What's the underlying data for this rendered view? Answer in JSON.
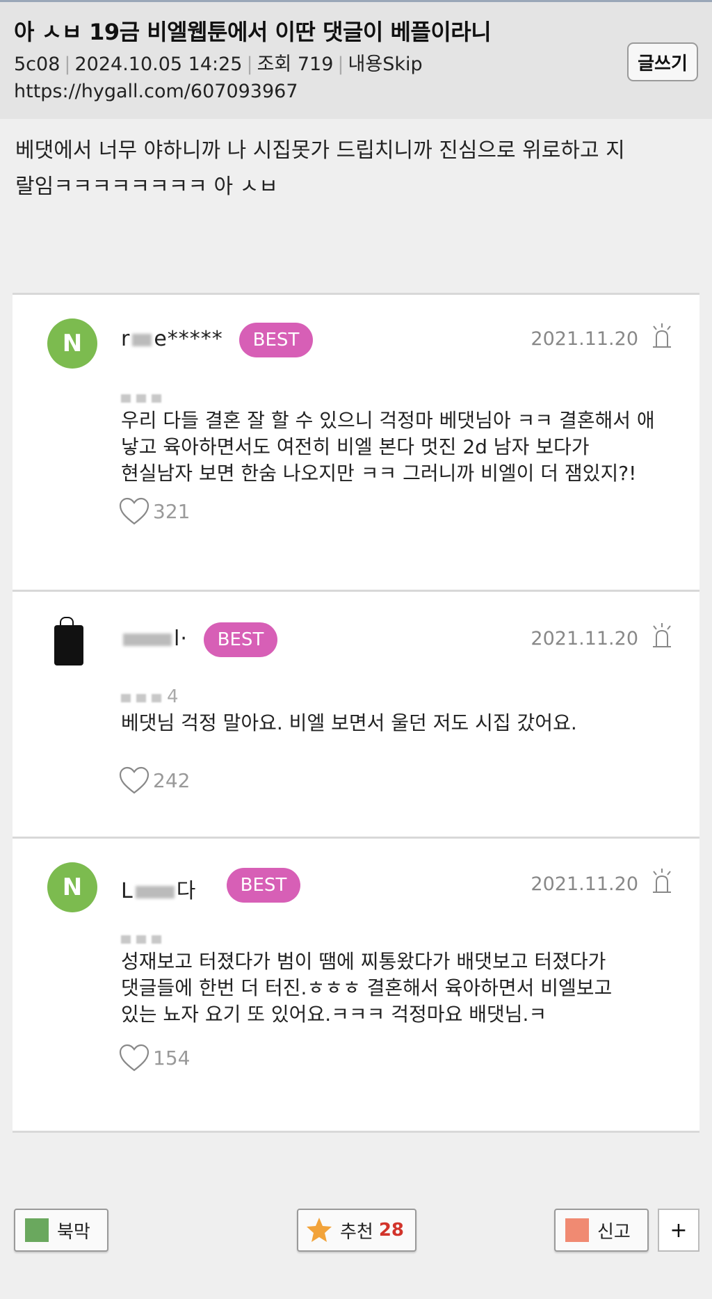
{
  "post": {
    "title": "아 ㅅㅂ 19금 비엘웹툰에서 이딴 댓글이 베플이라니",
    "author": "5c08",
    "datetime": "2024.10.05 14:25",
    "views_label": "조회 719",
    "skip_label": "내용Skip",
    "url": "https://hygall.com/607093967",
    "write_label": "글쓰기",
    "body_line1": "베댓에서 너무 야하니까 나 시집못가 드립치니까 진심으로 위로하고 지",
    "body_line2": "랄임ㅋㅋㅋㅋㅋㅋㅋㅋ 아 ㅅㅂ"
  },
  "comments": [
    {
      "avatar_letter": "N",
      "nickname_start": "r",
      "nickname_end": "e*****",
      "badge": "BEST",
      "date": "2021.11.20",
      "text_line1": "우리 다들 결혼 잘 할 수 있으니 걱정마 베댓님아 ㅋㅋ 결혼해서 애",
      "text_line2": "낳고 육아하면서도 여전히 비엘 본다 멋진 2d 남자 보다가",
      "text_line3": "현실남자 보면 한숨 나오지만 ㅋㅋ 그러니까 비엘이 더 잼있지?!",
      "likes": "321"
    },
    {
      "nickname_end": "l·",
      "badge": "BEST",
      "date": "2021.11.20",
      "subline_digit": "4",
      "text_line1": "베댓님 걱정 말아요. 비엘 보면서 울던 저도 시집 갔어요.",
      "likes": "242"
    },
    {
      "avatar_letter": "N",
      "nickname_start": "L",
      "nickname_end": "다",
      "badge": "BEST",
      "date": "2021.11.20",
      "text_line1": "성재보고 터졌다가 범이 땜에 찌통왔다가 배댓보고 터졌다가",
      "text_line2": "댓글들에 한번 더 터진.ㅎㅎㅎ 결혼해서 육아하면서 비엘보고",
      "text_line3": "있는 뇨자 요기 또 있어요.ㅋㅋㅋ 걱정마요 배댓님.ㅋ",
      "likes": "154"
    }
  ],
  "bottom_bar": {
    "bookmark_label": "북막",
    "recommend_label": "추천",
    "recommend_count": "28",
    "report_label": "신고",
    "plus_label": "+"
  },
  "colors": {
    "avatar_green": "#7cbb4f",
    "best_badge": "#d75fb6",
    "bookmark_swatch": "#6aa85e",
    "report_swatch": "#f08a72",
    "star": "#f2a33a",
    "recommend_count": "#d2342b"
  },
  "icons": {
    "report": "siren-icon",
    "like": "heart-outline-icon",
    "recommend": "star-icon"
  }
}
